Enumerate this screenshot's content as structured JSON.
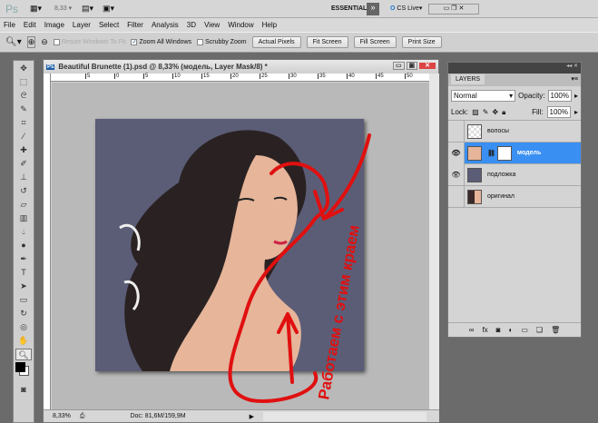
{
  "appbar": {
    "logo": "Ps",
    "zoom": "8,33",
    "workspace": "ESSENTIALS",
    "cslive": "CS Live"
  },
  "menu": [
    "File",
    "Edit",
    "Image",
    "Layer",
    "Select",
    "Filter",
    "Analysis",
    "3D",
    "View",
    "Window",
    "Help"
  ],
  "options": {
    "resize": "Resize Windows To Fit",
    "zoom_all": "Zoom All Windows",
    "scrubby": "Scrubby Zoom",
    "actual": "Actual Pixels",
    "fit": "Fit Screen",
    "fill": "Fill Screen",
    "print": "Print Size"
  },
  "document": {
    "title": "Beautiful Brunette (1).psd @ 8,33% (модель, Layer Mask/8) *",
    "ruler": [
      "5",
      "0",
      "5",
      "10",
      "15",
      "20",
      "25",
      "30",
      "35",
      "40",
      "45",
      "50"
    ],
    "zoom": "8,33%",
    "doc_info": "Doc: 81,6M/159,9M",
    "annotation": "Работаем с этим краем"
  },
  "layers": {
    "tab": "LAYERS",
    "blend": "Normal",
    "opacity_label": "Opacity:",
    "opacity": "100%",
    "lock_label": "Lock:",
    "fill_label": "Fill:",
    "fill": "100%",
    "items": [
      {
        "name": "волосы",
        "visible": false
      },
      {
        "name": "модель",
        "visible": true,
        "selected": true
      },
      {
        "name": "подложка",
        "visible": true
      },
      {
        "name": "оригинал",
        "visible": false
      }
    ]
  },
  "colors": {
    "canvas": "#5b5d77",
    "selection": "#3a8ff2",
    "annotation": "#e01010"
  }
}
